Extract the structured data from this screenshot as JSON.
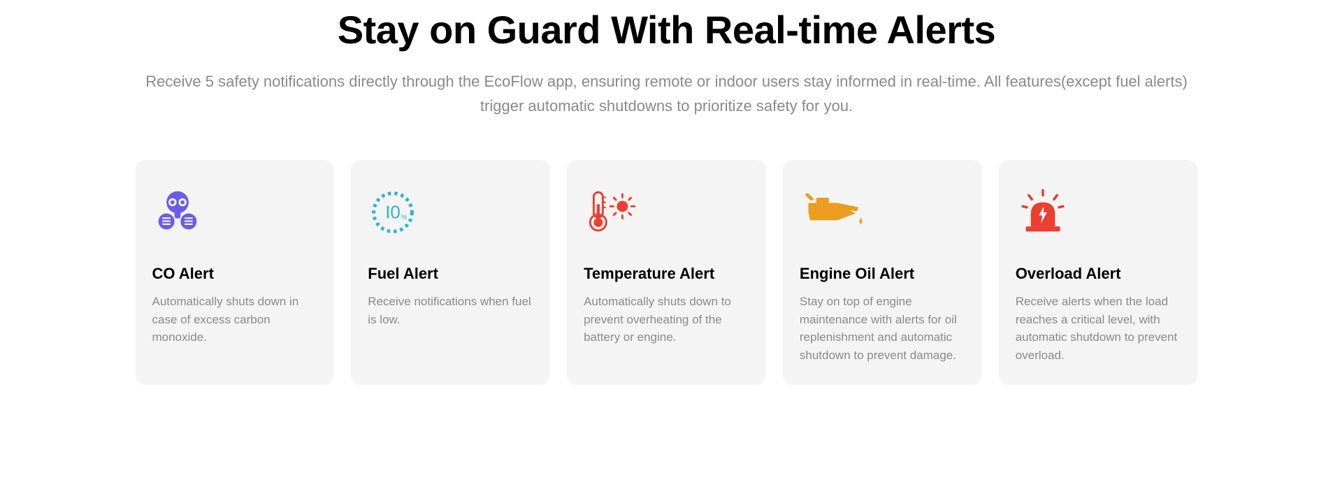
{
  "heading": "Stay on Guard With Real-time Alerts",
  "subheading": "Receive 5 safety notifications directly through the EcoFlow app, ensuring remote or indoor users stay informed in real-time. All features(except fuel alerts) trigger automatic shutdowns to prioritize safety for you.",
  "cards": [
    {
      "title": "CO Alert",
      "desc": "Automatically shuts down in case of excess carbon monoxide."
    },
    {
      "title": "Fuel Alert",
      "desc": "Receive notifications when fuel is low."
    },
    {
      "title": "Temperature Alert",
      "desc": "Automatically shuts down to prevent overheating of the battery or engine."
    },
    {
      "title": "Engine Oil Alert",
      "desc": "Stay on top of engine maintenance with alerts for oil replenishment and automatic shutdown to prevent damage."
    },
    {
      "title": "Overload Alert",
      "desc": "Receive alerts when the load reaches a critical level, with automatic shutdown to prevent overload."
    }
  ]
}
